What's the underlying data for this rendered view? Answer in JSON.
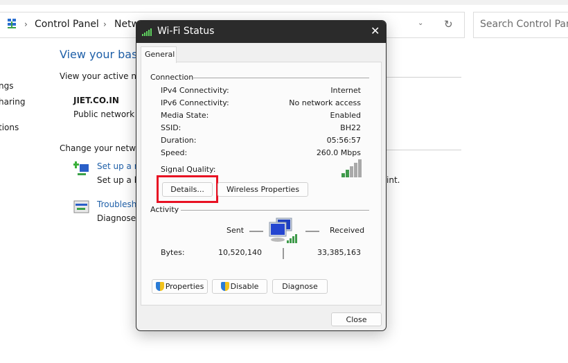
{
  "explorer": {
    "breadcrumb": [
      "Control Panel",
      "Netw"
    ],
    "search_placeholder": "Search Control Panel",
    "sidebar_fragments": [
      "ngs",
      "haring",
      "tions"
    ],
    "heading": "View your basic",
    "active_networks_label": "View your active netw",
    "network_name": "JIET.CO.IN",
    "network_type": "Public network",
    "change_label": "Change your networ",
    "tasks": [
      {
        "link": "Set up a ne",
        "desc": "Set up a br",
        "desc_tail": "int."
      },
      {
        "link": "Troublesho",
        "desc": "Diagnose a"
      }
    ]
  },
  "dialog": {
    "title": "Wi-Fi Status",
    "tab": "General",
    "connection_label": "Connection",
    "rows": [
      {
        "label": "IPv4 Connectivity:",
        "value": "Internet"
      },
      {
        "label": "IPv6 Connectivity:",
        "value": "No network access"
      },
      {
        "label": "Media State:",
        "value": "Enabled"
      },
      {
        "label": "SSID:",
        "value": "BH22"
      },
      {
        "label": "Duration:",
        "value": "05:56:57"
      },
      {
        "label": "Speed:",
        "value": "260.0 Mbps"
      }
    ],
    "signal_label": "Signal Quality:",
    "signal_bars": 2,
    "signal_bars_total": 5,
    "details_button": "Details...",
    "wireless_button": "Wireless Properties",
    "activity_label": "Activity",
    "sent_label": "Sent",
    "received_label": "Received",
    "bytes_label": "Bytes:",
    "bytes_sent": "10,520,140",
    "bytes_received": "33,385,163",
    "properties_button": "Properties",
    "disable_button": "Disable",
    "diagnose_button": "Diagnose",
    "close_button": "Close",
    "highlight_color": "#e81123"
  }
}
